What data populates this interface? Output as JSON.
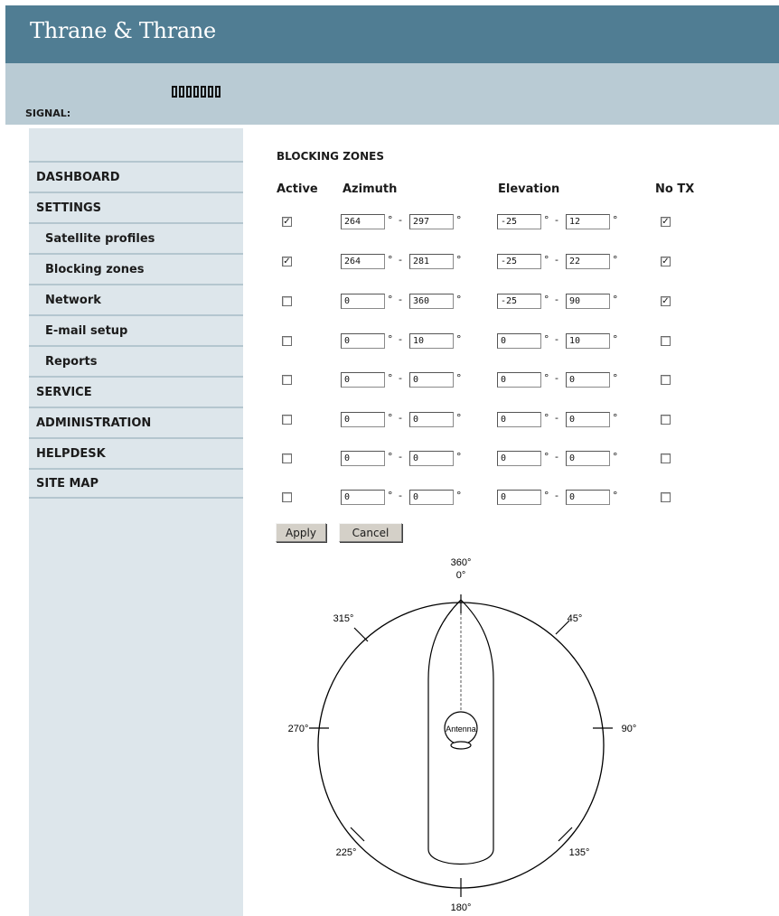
{
  "header": {
    "brand": "Thrane & Thrane"
  },
  "signal": {
    "label": "SIGNAL:",
    "bar_count": 7
  },
  "sidebar": {
    "items": [
      {
        "label": "DASHBOARD",
        "sub": false
      },
      {
        "label": "SETTINGS",
        "sub": false
      },
      {
        "label": "Satellite profiles",
        "sub": true
      },
      {
        "label": "Blocking zones",
        "sub": true
      },
      {
        "label": "Network",
        "sub": true
      },
      {
        "label": "E-mail setup",
        "sub": true
      },
      {
        "label": "Reports",
        "sub": true
      },
      {
        "label": "SERVICE",
        "sub": false
      },
      {
        "label": "ADMINISTRATION",
        "sub": false
      },
      {
        "label": "HELPDESK",
        "sub": false
      },
      {
        "label": "SITE MAP",
        "sub": false
      }
    ]
  },
  "main": {
    "title": "BLOCKING ZONES",
    "columns": {
      "active": "Active",
      "azimuth": "Azimuth",
      "elevation": "Elevation",
      "notx": "No TX"
    },
    "degree_symbol": "°",
    "range_separator": "-",
    "zones": [
      {
        "active": true,
        "az_from": "264",
        "az_to": "297",
        "el_from": "-25",
        "el_to": "12",
        "no_tx": true
      },
      {
        "active": true,
        "az_from": "264",
        "az_to": "281",
        "el_from": "-25",
        "el_to": "22",
        "no_tx": true
      },
      {
        "active": false,
        "az_from": "0",
        "az_to": "360",
        "el_from": "-25",
        "el_to": "90",
        "no_tx": true
      },
      {
        "active": false,
        "az_from": "0",
        "az_to": "10",
        "el_from": "0",
        "el_to": "10",
        "no_tx": false
      },
      {
        "active": false,
        "az_from": "0",
        "az_to": "0",
        "el_from": "0",
        "el_to": "0",
        "no_tx": false
      },
      {
        "active": false,
        "az_from": "0",
        "az_to": "0",
        "el_from": "0",
        "el_to": "0",
        "no_tx": false
      },
      {
        "active": false,
        "az_from": "0",
        "az_to": "0",
        "el_from": "0",
        "el_to": "0",
        "no_tx": false
      },
      {
        "active": false,
        "az_from": "0",
        "az_to": "0",
        "el_from": "0",
        "el_to": "0",
        "no_tx": false
      }
    ],
    "buttons": {
      "apply": "Apply",
      "cancel": "Cancel"
    }
  },
  "diagram": {
    "labels": {
      "top_a": "360°",
      "top_b": "0°",
      "ne": "45°",
      "e": "90°",
      "se": "135°",
      "s": "180°",
      "sw": "225°",
      "w": "270°",
      "nw": "315°",
      "antenna": "Antenna"
    }
  },
  "colors": {
    "header": "#507d93",
    "signal_bar": "#b9cbd4",
    "sidebar": "#dde6eb"
  }
}
